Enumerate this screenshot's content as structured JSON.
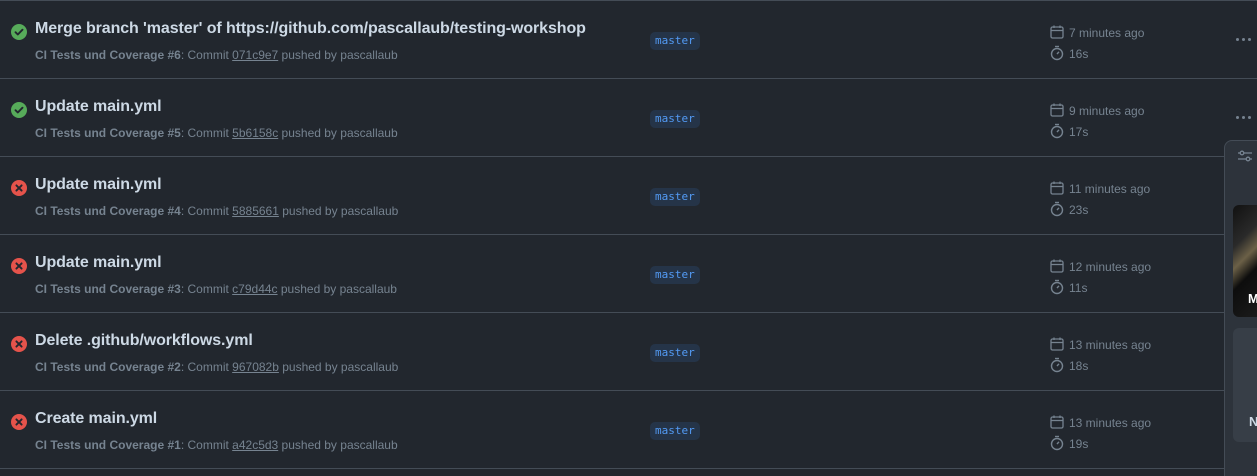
{
  "runs": [
    {
      "status": "success",
      "title": "Merge branch 'master' of https://github.com/pascallaub/testing-workshop",
      "workflow": "CI Tests und Coverage #6",
      "commit_prefix": ": Commit ",
      "sha": "071c9e7",
      "pushed_by": " pushed by pascallaub",
      "branch": "master",
      "time_ago": "7 minutes ago",
      "duration": "16s"
    },
    {
      "status": "success",
      "title": "Update main.yml",
      "workflow": "CI Tests und Coverage #5",
      "commit_prefix": ": Commit ",
      "sha": "5b6158c",
      "pushed_by": " pushed by pascallaub",
      "branch": "master",
      "time_ago": "9 minutes ago",
      "duration": "17s"
    },
    {
      "status": "failure",
      "title": "Update main.yml",
      "workflow": "CI Tests und Coverage #4",
      "commit_prefix": ": Commit ",
      "sha": "5885661",
      "pushed_by": " pushed by pascallaub",
      "branch": "master",
      "time_ago": "11 minutes ago",
      "duration": "23s"
    },
    {
      "status": "failure",
      "title": "Update main.yml",
      "workflow": "CI Tests und Coverage #3",
      "commit_prefix": ": Commit ",
      "sha": "c79d44c",
      "pushed_by": " pushed by pascallaub",
      "branch": "master",
      "time_ago": "12 minutes ago",
      "duration": "11s"
    },
    {
      "status": "failure",
      "title": "Delete .github/workflows.yml",
      "workflow": "CI Tests und Coverage #2",
      "commit_prefix": ": Commit ",
      "sha": "967082b",
      "pushed_by": " pushed by pascallaub",
      "branch": "master",
      "time_ago": "13 minutes ago",
      "duration": "18s"
    },
    {
      "status": "failure",
      "title": "Create main.yml",
      "workflow": "CI Tests und Coverage #1",
      "commit_prefix": ": Commit ",
      "sha": "a42c5d3",
      "pushed_by": " pushed by pascallaub",
      "branch": "master",
      "time_ago": "13 minutes ago",
      "duration": "19s"
    }
  ],
  "icons": {
    "success": "check-circle-icon",
    "failure": "x-circle-icon",
    "calendar": "calendar-icon",
    "stopwatch": "stopwatch-icon",
    "more": "kebab-horizontal-icon",
    "filter": "sliders-icon"
  },
  "colors": {
    "success": "#57ab5a",
    "failure": "#e5534b",
    "branch_text": "#539bf5",
    "branch_bg": "#253448",
    "background": "#22272e"
  },
  "overlay_panel": {
    "thumb_letter": "M",
    "card_letter": "N"
  }
}
